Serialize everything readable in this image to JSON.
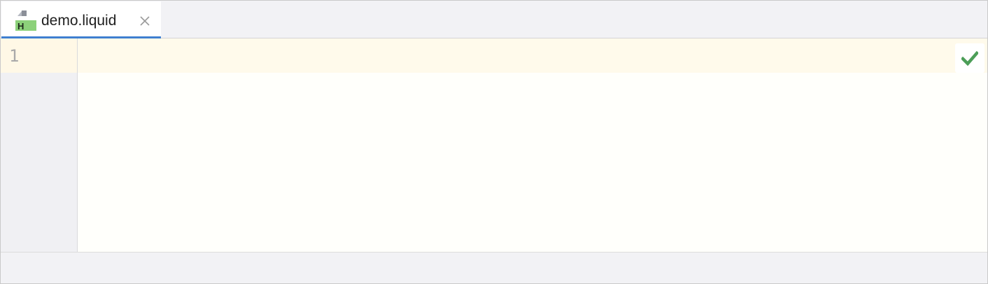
{
  "editor": {
    "tabs": [
      {
        "label": "demo.liquid",
        "icon": "liquid-file-icon",
        "icon_badge": "H",
        "active": true
      }
    ],
    "gutter": {
      "line_numbers": [
        "1"
      ]
    },
    "lines": [
      ""
    ],
    "inspection_status": "check-icon"
  },
  "colors": {
    "accent": "#3f7fd0",
    "file_badge": "#8cd17a",
    "ok_check": "#4c9e58",
    "current_line": "#fffaeb"
  }
}
